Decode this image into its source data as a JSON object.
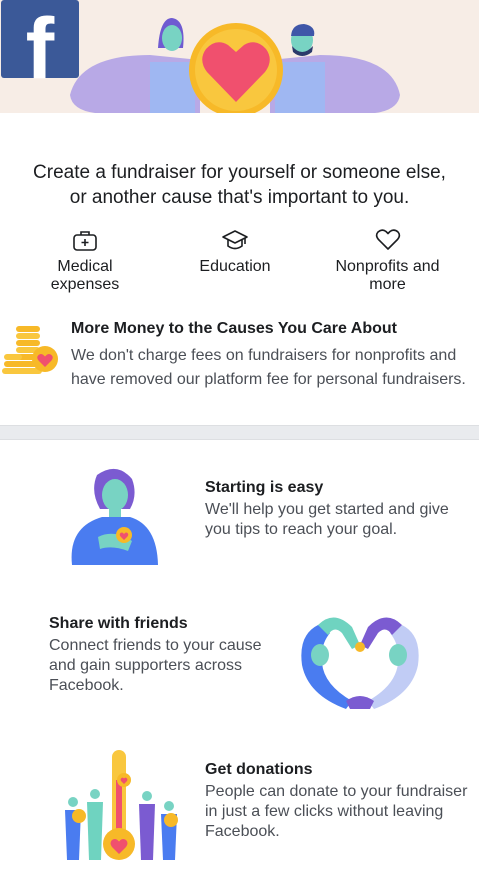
{
  "brand": {
    "logo_letter": "f"
  },
  "intro": {
    "line1": "Create a fundraiser for yourself or someone else,",
    "line2": "or another cause that's important to you."
  },
  "causes": [
    {
      "icon": "medical-kit-icon",
      "label_line1": "Medical",
      "label_line2": "expenses"
    },
    {
      "icon": "graduation-cap-icon",
      "label_line1": "Education",
      "label_line2": ""
    },
    {
      "icon": "heart-outline-icon",
      "label_line1": "Nonprofits and",
      "label_line2": "more"
    }
  ],
  "promo": {
    "title": "More Money to the Causes You Care About",
    "text": "We don't charge fees on fundraisers for nonprofits and have removed our platform fee for personal fundraisers."
  },
  "steps": [
    {
      "title": "Starting is easy",
      "text": "We'll help you get started and give you tips to reach your goal."
    },
    {
      "title": "Share with friends",
      "text": "Connect friends to your cause and gain supporters across Facebook."
    },
    {
      "title": "Get donations",
      "text": "People can donate to your fundraiser in just a few clicks without leaving Facebook."
    }
  ],
  "colors": {
    "brand_blue": "#3b5998",
    "heart_red": "#f0506e",
    "gold": "#f7b928",
    "hero_bg": "#f7ede6",
    "lavender": "#b8a9e6",
    "blue_figure": "#4a7cf0",
    "teal": "#6fd3c0"
  }
}
